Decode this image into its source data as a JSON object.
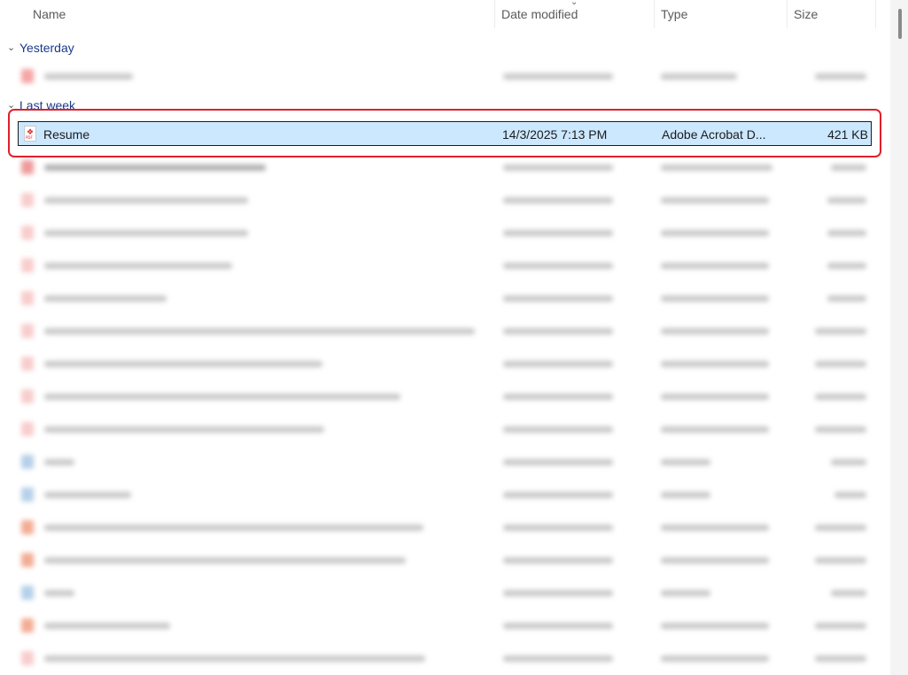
{
  "columns": {
    "name": "Name",
    "date_modified": "Date modified",
    "type": "Type",
    "size": "Size"
  },
  "groups": {
    "yesterday": "Yesterday",
    "last_week": "Last week"
  },
  "selected_file": {
    "name": "Resume",
    "date_modified": "14/3/2025 7:13 PM",
    "type": "Adobe Acrobat D...",
    "size": "421 KB",
    "icon": "pdf-file-icon"
  },
  "colors": {
    "selection_bg": "#cce8ff",
    "highlight_ring": "#e0202a",
    "group_text": "#1a3a8a"
  }
}
